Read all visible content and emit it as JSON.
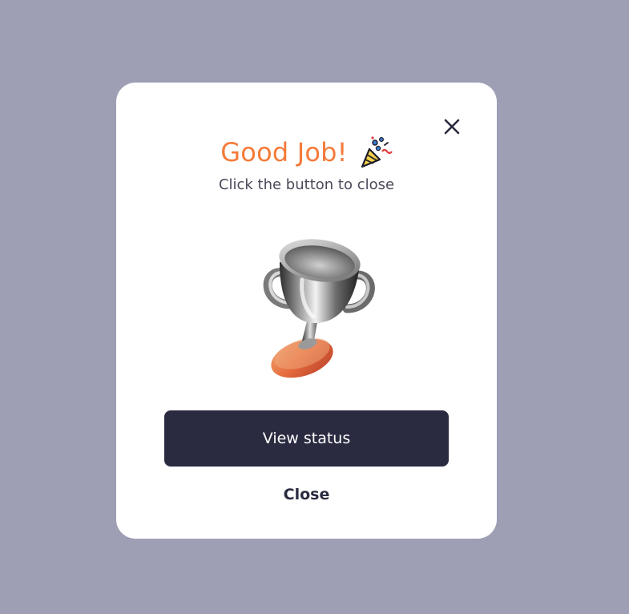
{
  "modal": {
    "title": "Good Job!",
    "subtitle": "Click the button to close",
    "primary_button_label": "View status",
    "secondary_button_label": "Close"
  },
  "icons": {
    "close": "close-icon",
    "celebration": "party-popper-icon",
    "illustration": "trophy-icon"
  },
  "colors": {
    "backdrop": "#9e9fb5",
    "title_accent": "#f47b3a",
    "primary_button": "#2a2b40",
    "subtitle_text": "#4a4a5a"
  }
}
